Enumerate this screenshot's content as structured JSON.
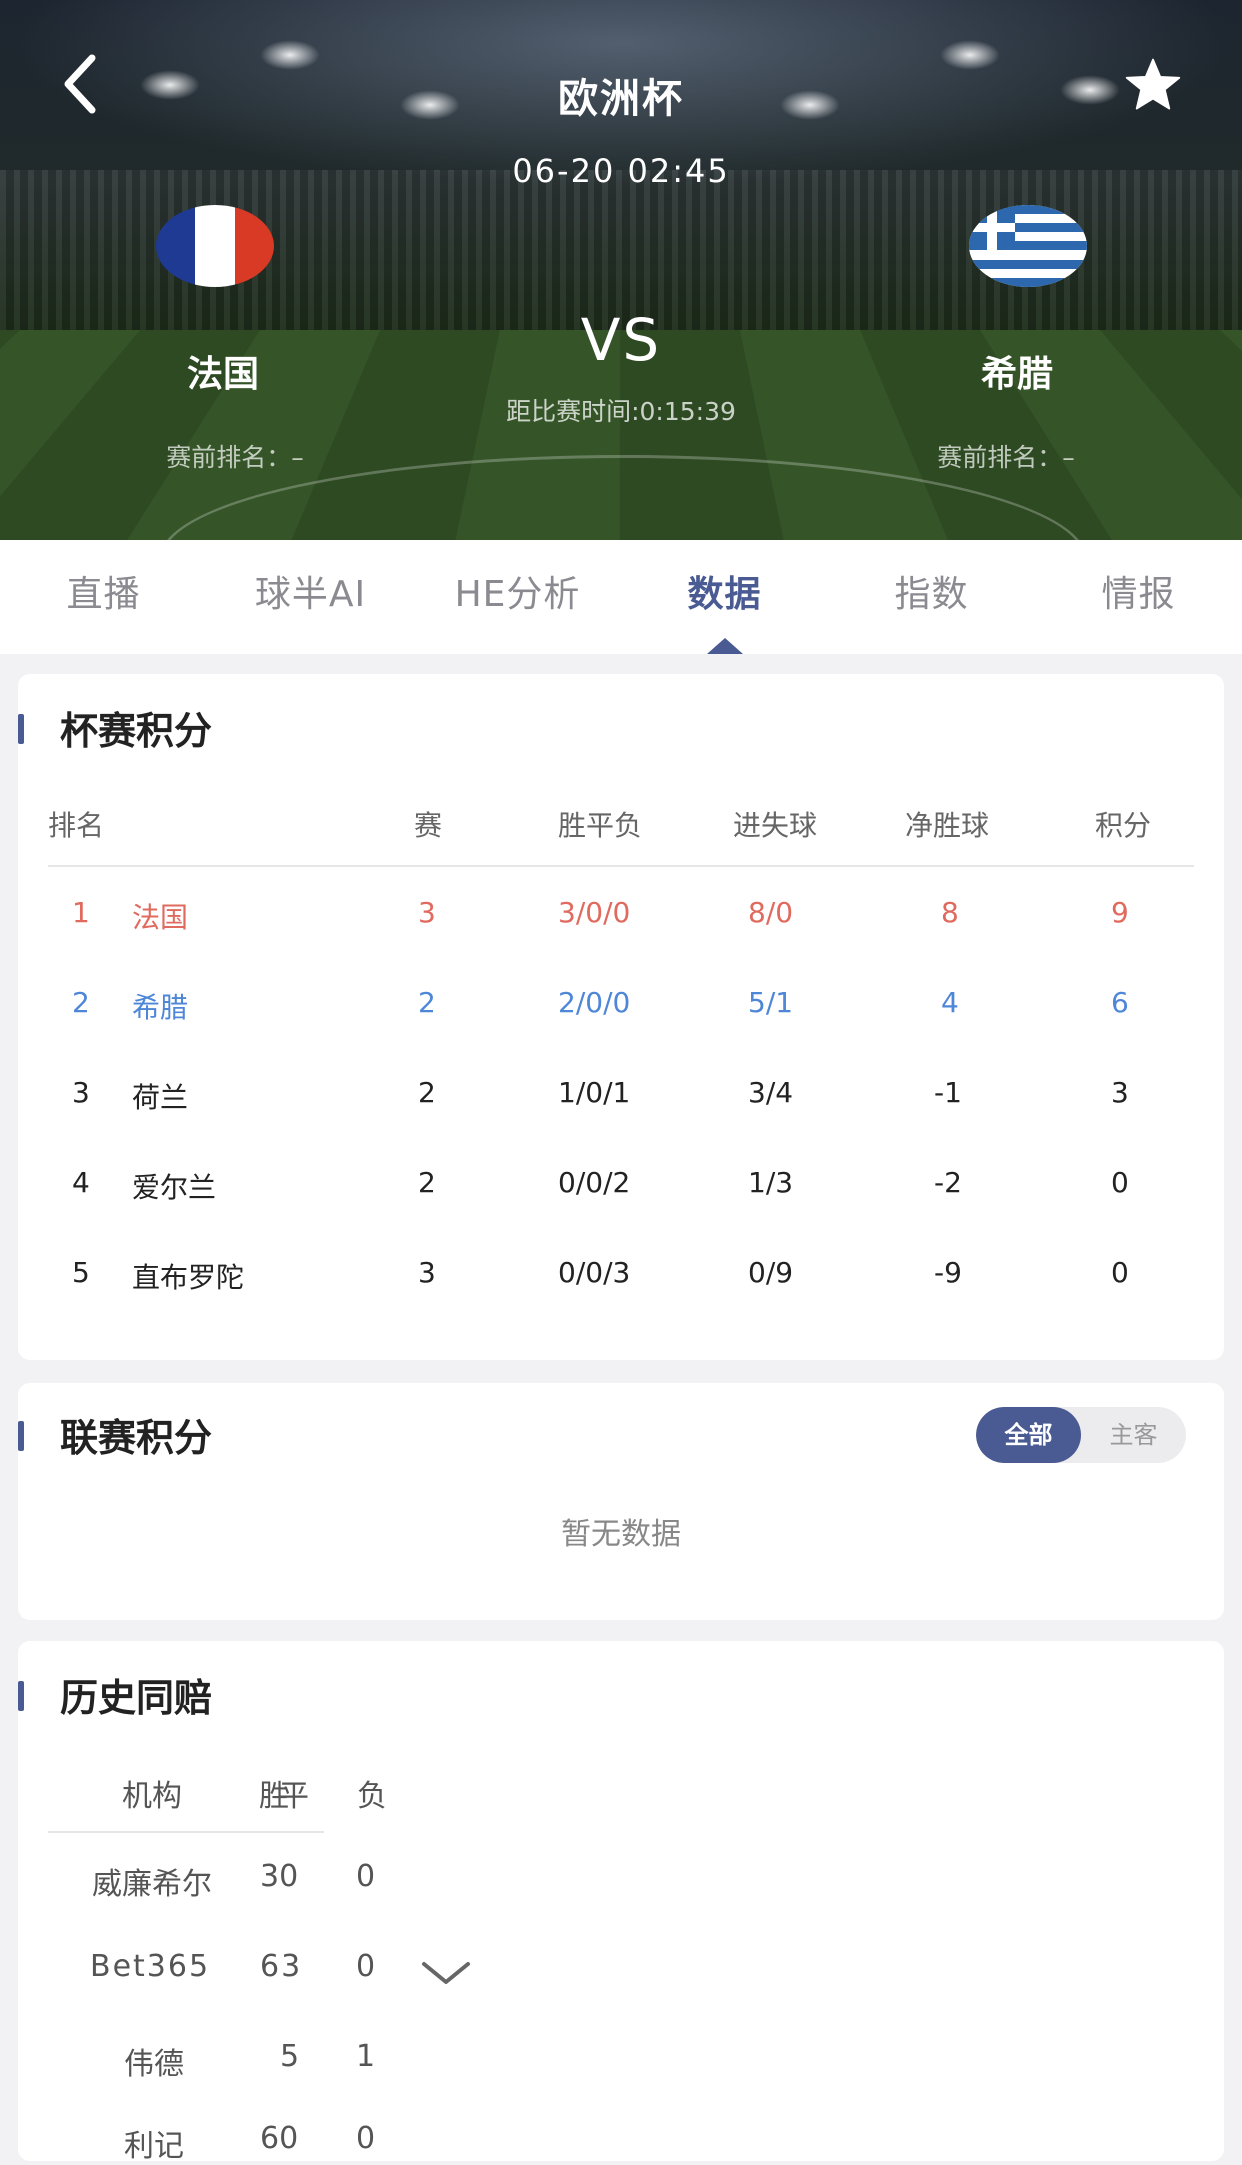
{
  "header": {
    "title": "欧洲杯",
    "datetime": "06-20 02:45",
    "vs": "VS",
    "countdown": "距比赛时间:0:15:39",
    "home": {
      "name": "法国",
      "rank": "赛前排名：–"
    },
    "away": {
      "name": "希腊",
      "rank": "赛前排名：–"
    }
  },
  "tabs": [
    {
      "label": "直播"
    },
    {
      "label": "球半AI"
    },
    {
      "label": "HE分析"
    },
    {
      "label": "数据"
    },
    {
      "label": "指数"
    },
    {
      "label": "情报"
    }
  ],
  "cup_standings": {
    "title": "杯赛积分",
    "headers": [
      "排名",
      "赛",
      "胜平负",
      "进失球",
      "净胜球",
      "积分"
    ],
    "rows": [
      {
        "rank": "1",
        "team": "法国",
        "played": "3",
        "wdl": "3/0/0",
        "goals": "8/0",
        "gd": "8",
        "pts": "9"
      },
      {
        "rank": "2",
        "team": "希腊",
        "played": "2",
        "wdl": "2/0/0",
        "goals": "5/1",
        "gd": "4",
        "pts": "6"
      },
      {
        "rank": "3",
        "team": "荷兰",
        "played": "2",
        "wdl": "1/0/1",
        "goals": "3/4",
        "gd": "-1",
        "pts": "3"
      },
      {
        "rank": "4",
        "team": "爱尔兰",
        "played": "2",
        "wdl": "0/0/2",
        "goals": "1/3",
        "gd": "-2",
        "pts": "0"
      },
      {
        "rank": "5",
        "team": "直布罗陀",
        "played": "3",
        "wdl": "0/0/3",
        "goals": "0/9",
        "gd": "-9",
        "pts": "0"
      }
    ]
  },
  "league_standings": {
    "title": "联赛积分",
    "toggle": [
      "全部",
      "主客"
    ],
    "empty": "暂无数据"
  },
  "history_odds": {
    "title": "历史同赔",
    "headers": [
      "机构",
      "胜",
      "平",
      "负"
    ],
    "rows": [
      {
        "company": "威廉希尔",
        "win": "30",
        "lose": "0"
      },
      {
        "company": "Bet365",
        "win": "63",
        "lose": "0"
      },
      {
        "company": "伟德",
        "win": "5",
        "lose": "1"
      },
      {
        "company": "利记",
        "win": "60",
        "lose": "0"
      }
    ]
  },
  "colors": {
    "accent": "#4a5a93",
    "home": "#e06a5e",
    "away": "#4e86d8"
  }
}
